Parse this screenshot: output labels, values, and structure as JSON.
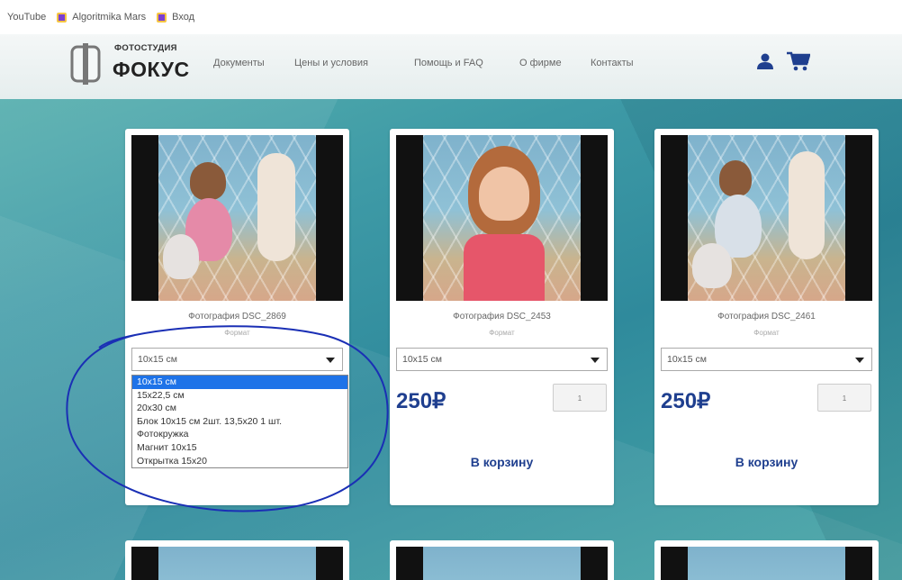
{
  "bookmarks": [
    "YouTube",
    "Algoritmika Mars",
    "Вход"
  ],
  "header": {
    "logo_small": "ФОТОСТУДИЯ",
    "logo_big": "ФОКУС",
    "nav": [
      "Документы",
      "Цены и условия",
      "Помощь и FAQ",
      "О фирме",
      "Контакты"
    ]
  },
  "cards": [
    {
      "title": "Фотография DSC_2869",
      "format_label": "Формат",
      "selected": "10x15 см"
    },
    {
      "title": "Фотография DSC_2453",
      "format_label": "Формат",
      "selected": "10x15 см",
      "price": "250₽",
      "qty": "1",
      "cart_label": "В корзину"
    },
    {
      "title": "Фотография DSC_2461",
      "format_label": "Формат",
      "selected": "10x15 см",
      "price": "250₽",
      "qty": "1",
      "cart_label": "В корзину"
    }
  ],
  "dropdown": {
    "options": [
      "10x15 см",
      "15x22,5 см",
      "20x30 см",
      "Блок 10x15 см 2шт. 13,5x20 1 шт.",
      "Фотокружка",
      "Магнит 10x15",
      "Открытка 15x20"
    ],
    "active_index": 0
  },
  "colors": {
    "accent": "#1f3f8f",
    "highlight": "#1e73e8",
    "annotation": "#1a2fb5"
  }
}
